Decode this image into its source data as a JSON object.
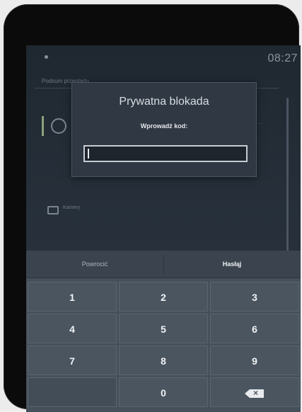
{
  "status": {
    "time": "08:27"
  },
  "background": {
    "heading": "Podsum przeglądu",
    "right_label": "...",
    "camera_item_label": "Kamery"
  },
  "dialog": {
    "title": "Prywatna blokada",
    "prompt": "Wprowadź kod:",
    "input_value": "",
    "input_placeholder": ""
  },
  "keypad": {
    "cancel_label": "Powrocić",
    "confirm_label": "Hasłąj",
    "keys": [
      "1",
      "2",
      "3",
      "4",
      "5",
      "6",
      "7",
      "8",
      "9",
      "",
      "0",
      ""
    ],
    "backspace_icon": "backspace-icon"
  },
  "colors": {
    "screen_bg": "#262f39",
    "dialog_bg": "#2f3843",
    "keypad_bg": "#46505b",
    "key_bg": "#4a5560"
  }
}
